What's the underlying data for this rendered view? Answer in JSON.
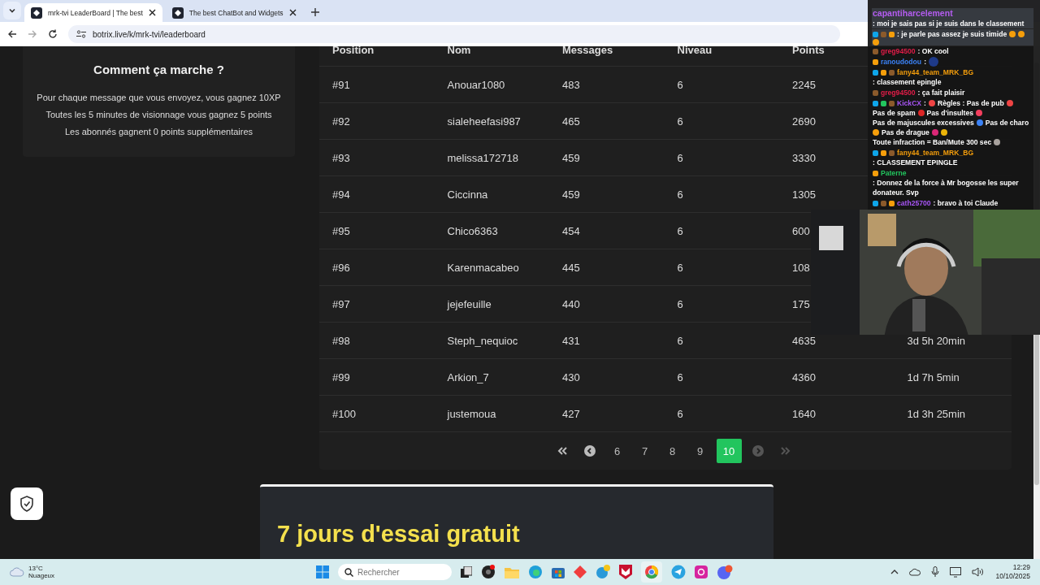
{
  "browser": {
    "tabs": [
      {
        "title": "mrk-tvi LeaderBoard | The best",
        "selected": true
      },
      {
        "title": "The best ChatBot and Widgets",
        "selected": false
      }
    ],
    "url": "botrix.live/k/mrk-tvi/leaderboard"
  },
  "info_card": {
    "title": "Comment ça marche ?",
    "lines": [
      "Pour chaque message que vous envoyez, vous gagnez 10XP",
      "Toutes les 5 minutes de visionnage vous gagnez 5 points",
      "Les abonnés gagnent 0 points supplémentaires"
    ]
  },
  "table": {
    "columns": [
      "Position",
      "Nom",
      "Messages",
      "Niveau",
      "Points"
    ],
    "rows": [
      {
        "position": "#91",
        "name": "Anouar1080",
        "messages": "483",
        "level": "6",
        "points": "2245"
      },
      {
        "position": "#92",
        "name": "sialeheefasi987",
        "messages": "465",
        "level": "6",
        "points": "2690"
      },
      {
        "position": "#93",
        "name": "melissa172718",
        "messages": "459",
        "level": "6",
        "points": "3330"
      },
      {
        "position": "#94",
        "name": "Ciccinna",
        "messages": "459",
        "level": "6",
        "points": "1305"
      },
      {
        "position": "#95",
        "name": "Chico6363",
        "messages": "454",
        "level": "6",
        "points": "600"
      },
      {
        "position": "#96",
        "name": "Karenmacabeo",
        "messages": "445",
        "level": "6",
        "points": "108"
      },
      {
        "position": "#97",
        "name": "jejefeuille",
        "messages": "440",
        "level": "6",
        "points": "175"
      },
      {
        "position": "#98",
        "name": "Steph_nequioc",
        "messages": "431",
        "level": "6",
        "points": "4635",
        "watchtime": "3d 5h 20min"
      },
      {
        "position": "#99",
        "name": "Arkion_7",
        "messages": "430",
        "level": "6",
        "points": "4360",
        "watchtime": "1d 7h 5min"
      },
      {
        "position": "#100",
        "name": "justemoua",
        "messages": "427",
        "level": "6",
        "points": "1640",
        "watchtime": "1d 3h 25min"
      }
    ]
  },
  "pagination": {
    "pages": [
      {
        "label": "6",
        "selected": false
      },
      {
        "label": "7",
        "selected": false
      },
      {
        "label": "8",
        "selected": false
      },
      {
        "label": "9",
        "selected": false
      },
      {
        "label": "10",
        "selected": true
      }
    ],
    "next_disabled": true
  },
  "promo": {
    "title": "7 jours d'essai gratuit"
  },
  "chat": [
    {
      "light": true,
      "user": {
        "name": "capantiharcelement",
        "color": "#b45cf0"
      },
      "segments": [
        {
          "kind": "text",
          "text": ": moi je sais pas si je suis dans le classement"
        }
      ]
    },
    {
      "light": true,
      "badges": [
        {
          "color": "#0ea5e9"
        },
        {
          "color": "#8b5a2b"
        },
        {
          "color": "#f59e0b"
        }
      ],
      "segments": [
        {
          "kind": "text",
          "text": ": je parle pas assez je suis timide"
        },
        {
          "kind": "emoji",
          "color": "#f59e0b"
        },
        {
          "kind": "emoji",
          "color": "#f59e0b"
        },
        {
          "kind": "emoji",
          "color": "#f59e0b"
        }
      ]
    },
    {
      "light": false,
      "badges": [
        {
          "color": "#8b5a2b"
        }
      ],
      "user": {
        "name": "greg94500",
        "color": "#e11d48"
      },
      "segments": [
        {
          "kind": "text",
          "text": ": OK cool"
        }
      ]
    },
    {
      "light": false,
      "badges": [
        {
          "color": "#f59e0b"
        }
      ],
      "user": {
        "name": "ranoudodou",
        "color": "#3b82f6"
      },
      "segments": [
        {
          "kind": "text",
          "text": ":"
        },
        {
          "kind": "emote",
          "color": "#1e3a8a"
        }
      ]
    },
    {
      "light": false,
      "badges": [
        {
          "color": "#0ea5e9"
        },
        {
          "color": "#f59e0b"
        },
        {
          "color": "#8b5a2b"
        }
      ],
      "user": {
        "name": "fany44_team_MRK_BG",
        "color": "#f59e0b"
      },
      "segments": [
        {
          "kind": "text",
          "text": ": classement epingle"
        }
      ]
    },
    {
      "light": false,
      "badges": [
        {
          "color": "#8b5a2b"
        }
      ],
      "user": {
        "name": "greg94500",
        "color": "#e11d48"
      },
      "segments": [
        {
          "kind": "text",
          "text": ": ça fait plaisir"
        }
      ]
    },
    {
      "light": false,
      "badges": [
        {
          "color": "#0ea5e9"
        },
        {
          "color": "#22c55e"
        },
        {
          "color": "#8b5a2b"
        }
      ],
      "user": {
        "name": "KickCX",
        "color": "#a855f7"
      },
      "segments": [
        {
          "kind": "text",
          "text": ":"
        },
        {
          "kind": "emoji",
          "color": "#ef4444"
        },
        {
          "kind": "text",
          "text": "Règles : Pas de pub"
        },
        {
          "kind": "emoji",
          "color": "#ef4444"
        },
        {
          "kind": "text",
          "text": "Pas de spam"
        },
        {
          "kind": "emoji",
          "color": "#dc2626"
        },
        {
          "kind": "text",
          "text": "Pas d'insultes"
        },
        {
          "kind": "emoji",
          "color": "#f43f5e"
        },
        {
          "kind": "text",
          "text": "Pas de majuscules excessives"
        },
        {
          "kind": "emoji",
          "color": "#3b82f6"
        },
        {
          "kind": "text",
          "text": "Pas de charo"
        },
        {
          "kind": "emoji",
          "color": "#f59e0b"
        },
        {
          "kind": "text",
          "text": "Pas de drague"
        },
        {
          "kind": "emoji",
          "color": "#db2777"
        },
        {
          "kind": "emoji",
          "color": "#eab308"
        },
        {
          "kind": "text",
          "text": "Toute infraction = Ban/Mute 300 sec"
        },
        {
          "kind": "emoji",
          "color": "#a8a29e"
        }
      ]
    },
    {
      "light": false,
      "badges": [
        {
          "color": "#0ea5e9"
        },
        {
          "color": "#f59e0b"
        },
        {
          "color": "#8b5a2b"
        }
      ],
      "user": {
        "name": "fany44_team_MRK_BG",
        "color": "#f59e0b"
      },
      "segments": [
        {
          "kind": "text",
          "text": ": CLASSEMENT EPINGLE"
        }
      ]
    },
    {
      "light": false,
      "badges": [
        {
          "color": "#f59e0b"
        }
      ],
      "user": {
        "name": "Paterne",
        "color": "#22c55e"
      },
      "segments": [
        {
          "kind": "text",
          "text": ": Donnez de la force à Mr bogosse les super donateur. Svp"
        }
      ]
    },
    {
      "light": false,
      "badges": [
        {
          "color": "#0ea5e9"
        },
        {
          "color": "#8b5a2b"
        },
        {
          "color": "#f59e0b"
        }
      ],
      "user": {
        "name": "cath25700",
        "color": "#a855f7"
      },
      "segments": [
        {
          "kind": "text",
          "text": ": bravo à toi Claude"
        }
      ]
    }
  ],
  "taskbar": {
    "weather": {
      "temp": "13°C",
      "condition": "Nuageux"
    },
    "search": {
      "placeholder": "Rechercher"
    },
    "time": "12:29",
    "date": "10/10/2025"
  }
}
